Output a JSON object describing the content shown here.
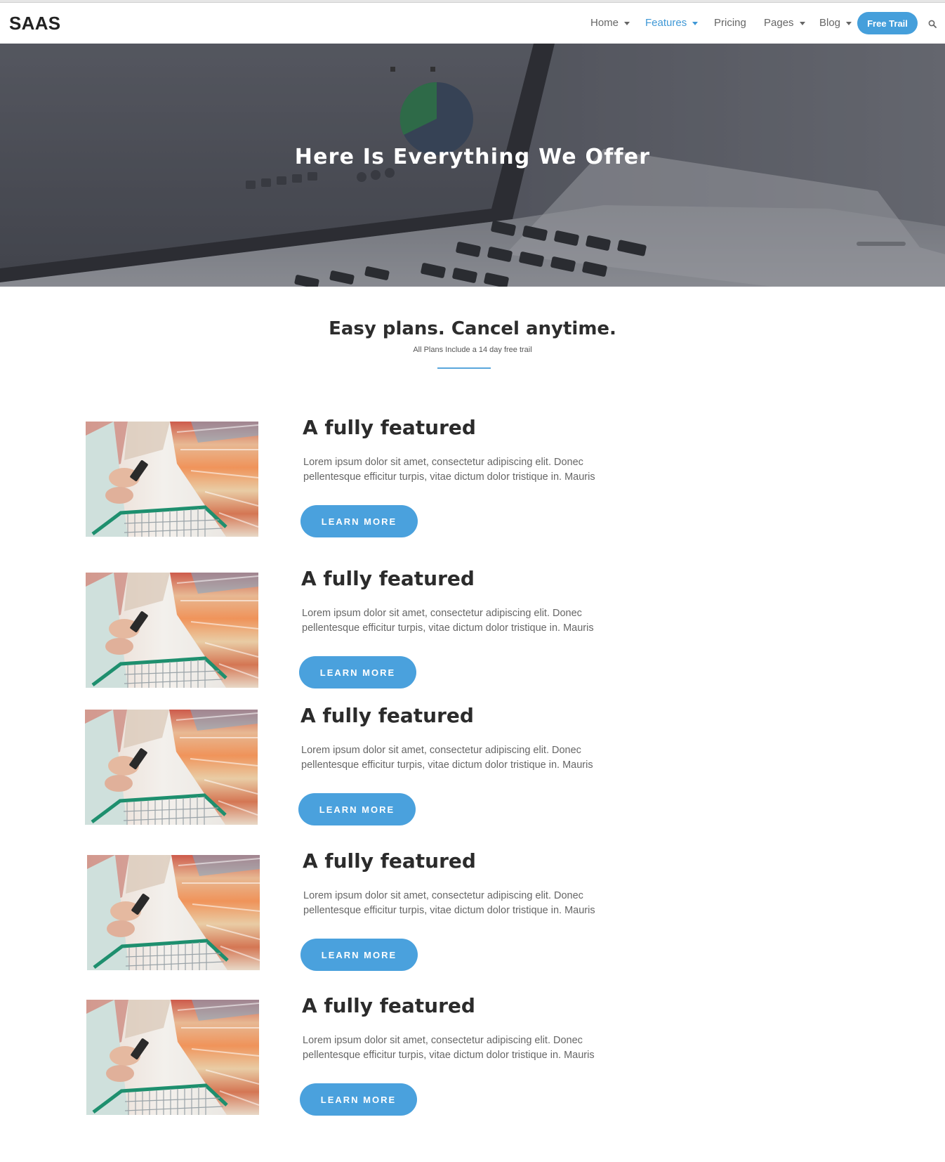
{
  "navbar": {
    "brand": "SAAS",
    "items": [
      {
        "label": "Home",
        "has_caret": true,
        "active": false
      },
      {
        "label": "Features",
        "has_caret": true,
        "active": true
      },
      {
        "label": "Pricing",
        "has_caret": false,
        "active": false
      },
      {
        "label": "Pages",
        "has_caret": true,
        "active": false
      },
      {
        "label": "Blog",
        "has_caret": true,
        "active": false
      }
    ],
    "cta_label": "Free Trail",
    "search_icon": "search-icon"
  },
  "hero": {
    "title": "Here Is Everything We Offer"
  },
  "intro": {
    "title": "Easy plans. Cancel anytime.",
    "subtitle": "All Plans Include a 14 day free trail"
  },
  "features": [
    {
      "title": "A fully featured",
      "text": "Lorem ipsum dolor sit amet, consectetur adipiscing elit. Donec pellentesque efficitur turpis, vitae dictum dolor tristique in. Mauris",
      "button": "LEARN MORE"
    },
    {
      "title": "A fully featured",
      "text": "Lorem ipsum dolor sit amet, consectetur adipiscing elit. Donec pellentesque efficitur turpis, vitae dictum dolor tristique in. Mauris",
      "button": "LEARN MORE"
    },
    {
      "title": "A fully featured",
      "text": "Lorem ipsum dolor sit amet, consectetur adipiscing elit. Donec pellentesque efficitur turpis, vitae dictum dolor tristique in. Mauris",
      "button": "LEARN MORE"
    },
    {
      "title": "A fully featured",
      "text": "Lorem ipsum dolor sit amet, consectetur adipiscing elit. Donec pellentesque efficitur turpis, vitae dictum dolor tristique in. Mauris",
      "button": "LEARN MORE"
    },
    {
      "title": "A fully featured",
      "text": "Lorem ipsum dolor sit amet, consectetur adipiscing elit. Donec pellentesque efficitur turpis, vitae dictum dolor tristique in. Mauris",
      "button": "LEARN MORE"
    }
  ],
  "colors": {
    "accent": "#459fdb",
    "active_nav": "#3f98d6",
    "heading": "#2b2b2b",
    "body_text": "#666666"
  }
}
